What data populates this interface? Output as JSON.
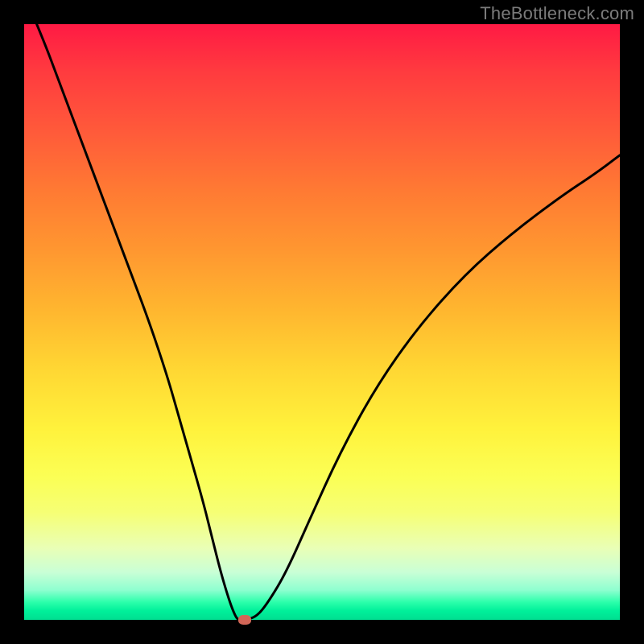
{
  "watermark": "TheBottleneck.com",
  "colors": {
    "frame": "#000000",
    "curve": "#000000",
    "marker": "#d26657"
  },
  "chart_data": {
    "type": "line",
    "title": "",
    "xlabel": "",
    "ylabel": "",
    "xlim": [
      0,
      100
    ],
    "ylim": [
      0,
      100
    ],
    "grid": false,
    "series": [
      {
        "name": "bottleneck-curve",
        "x": [
          0,
          3,
          6,
          9,
          12,
          15,
          18,
          21,
          24,
          26,
          28,
          30,
          31.5,
          33,
          34.5,
          35.5,
          36,
          36.5,
          37,
          39,
          41,
          44,
          48,
          53,
          59,
          66,
          74,
          82,
          90,
          96,
          100
        ],
        "y": [
          105,
          98,
          90,
          82,
          74,
          66,
          58,
          50,
          41,
          34,
          27,
          20,
          14,
          8,
          3,
          0.5,
          0,
          0,
          0,
          0.5,
          3,
          8,
          17,
          28,
          39,
          49,
          58,
          65,
          71,
          75,
          78
        ]
      }
    ],
    "marker": {
      "x": 37,
      "y": 0
    },
    "background_gradient": [
      "#ff1a44",
      "#ff3b3f",
      "#ff5a3a",
      "#ff7a33",
      "#ff9730",
      "#ffb62f",
      "#ffd733",
      "#fff23c",
      "#fbff55",
      "#f6ff75",
      "#e9ffb6",
      "#c9ffd6",
      "#8effd0",
      "#2dffab",
      "#00f09a",
      "#00de91"
    ]
  }
}
